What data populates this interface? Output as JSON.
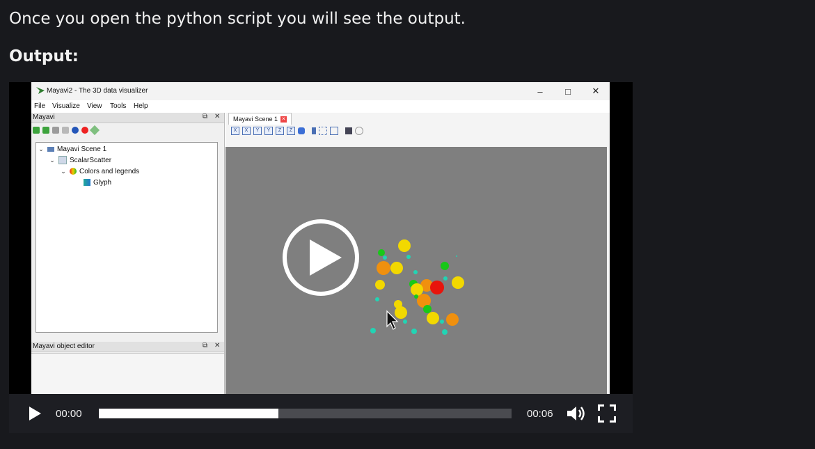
{
  "article": {
    "intro_text": "Once you open the python script you will see the output.",
    "output_heading": "Output:"
  },
  "video": {
    "current_time": "00:00",
    "duration": "00:06",
    "buffered_fraction": 0.435,
    "controls": {
      "play_icon": "play-icon",
      "volume_icon": "volume-icon",
      "fullscreen_icon": "fullscreen-icon",
      "big_play_icon": "big-play-icon"
    },
    "frame": {
      "window_title": "Mayavi2 - The 3D data visualizer",
      "menu": [
        "File",
        "Visualize",
        "View",
        "Tools",
        "Help"
      ],
      "left_pane_title": "Mayavi",
      "tree": {
        "scene": "Mayavi Scene 1",
        "source": "ScalarScatter",
        "module_manager": "Colors and legends",
        "glyph": "Glyph"
      },
      "editor_title": "Mayavi object editor",
      "scene_tab": "Mayavi Scene 1",
      "view_buttons": [
        "X",
        "X",
        "Y",
        "Y",
        "Z",
        "Z"
      ],
      "colors": {
        "viewport": "#7f7f7f",
        "red": "#e8140c",
        "orange": "#f0900e",
        "yellow": "#f2d800",
        "green": "#18c818",
        "cyan": "#22d4b4"
      }
    }
  }
}
